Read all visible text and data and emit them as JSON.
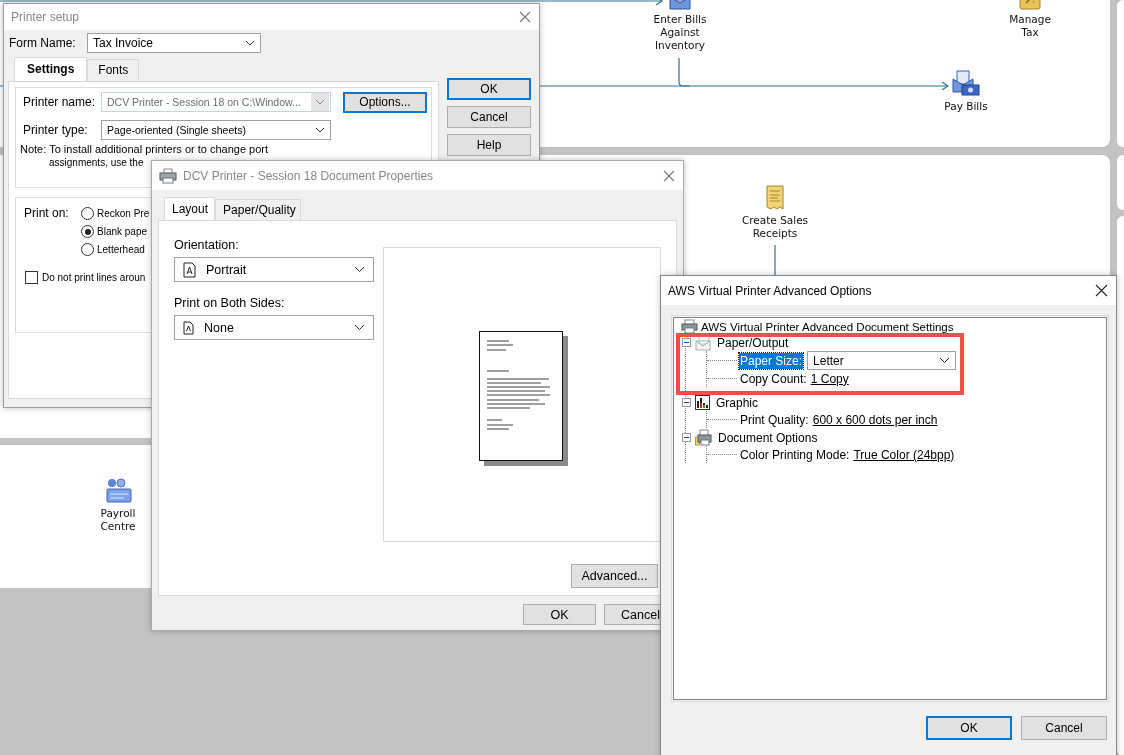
{
  "workflow": {
    "nodes": [
      {
        "label": "Enter Bills Against Inventory"
      },
      {
        "label": "Manage Tax"
      },
      {
        "label": "Pay Bills"
      },
      {
        "label": "Create Sales Receipts"
      },
      {
        "label": "Payroll Centre"
      }
    ]
  },
  "printer_setup": {
    "title": "Printer setup",
    "form_name_label": "Form Name:",
    "form_name": "Tax Invoice",
    "tabs": [
      {
        "label": "Settings",
        "selected": true
      },
      {
        "label": "Fonts",
        "selected": false
      }
    ],
    "printer_name_label": "Printer name:",
    "printer_name": "DCV Printer - Session 18 on C:\\Window...",
    "printer_name_disabled": true,
    "options_button": "Options...",
    "printer_type_label": "Printer type:",
    "printer_type": "Page-oriented (Single sheets)",
    "note": [
      "Note: To install additional printers or to change port",
      "assignments, use the"
    ],
    "print_on_label": "Print on:",
    "print_on_options": [
      {
        "label": "Reckon Pre",
        "selected": false
      },
      {
        "label": "Blank pape",
        "selected": true
      },
      {
        "label": "Letterhead",
        "selected": false
      }
    ],
    "checkbox": {
      "label": "Do not print lines aroun",
      "checked": false
    },
    "buttons": [
      {
        "label": "OK",
        "default": true
      },
      {
        "label": "Cancel",
        "default": false
      },
      {
        "label": "Help",
        "default": false
      }
    ]
  },
  "document_properties": {
    "title": "DCV Printer - Session 18 Document Properties",
    "tabs": [
      {
        "label": "Layout",
        "selected": true
      },
      {
        "label": "Paper/Quality",
        "selected": false
      }
    ],
    "orientation_label": "Orientation:",
    "orientation": "Portrait",
    "both_sides_label": "Print on Both Sides:",
    "both_sides": "None",
    "advanced_button": "Advanced...",
    "buttons": [
      {
        "label": "OK",
        "default": false
      },
      {
        "label": "Cancel",
        "default": false
      }
    ]
  },
  "advanced_options": {
    "title": "AWS Virtual Printer Advanced Options",
    "tree": {
      "label": "AWS Virtual Printer Advanced Document Settings",
      "children": [
        {
          "label": "Paper/Output",
          "expanded": true,
          "children": [
            {
              "kind": "dropdown",
              "label": "Paper Size:",
              "selected": true,
              "value": "Letter"
            },
            {
              "kind": "link",
              "label": "Copy Count:",
              "selected": false,
              "value": "1 Copy"
            }
          ]
        },
        {
          "label": "Graphic",
          "expanded": true,
          "children": [
            {
              "kind": "link",
              "label": "Print Quality:",
              "selected": false,
              "value": "600 x 600 dots per inch"
            }
          ]
        },
        {
          "label": "Document Options",
          "expanded": true,
          "children": [
            {
              "kind": "link",
              "label": "Color Printing Mode:",
              "selected": false,
              "value": "True Color (24bpp)"
            }
          ]
        }
      ]
    },
    "buttons": [
      {
        "label": "OK",
        "default": true
      },
      {
        "label": "Cancel",
        "default": false
      }
    ]
  }
}
